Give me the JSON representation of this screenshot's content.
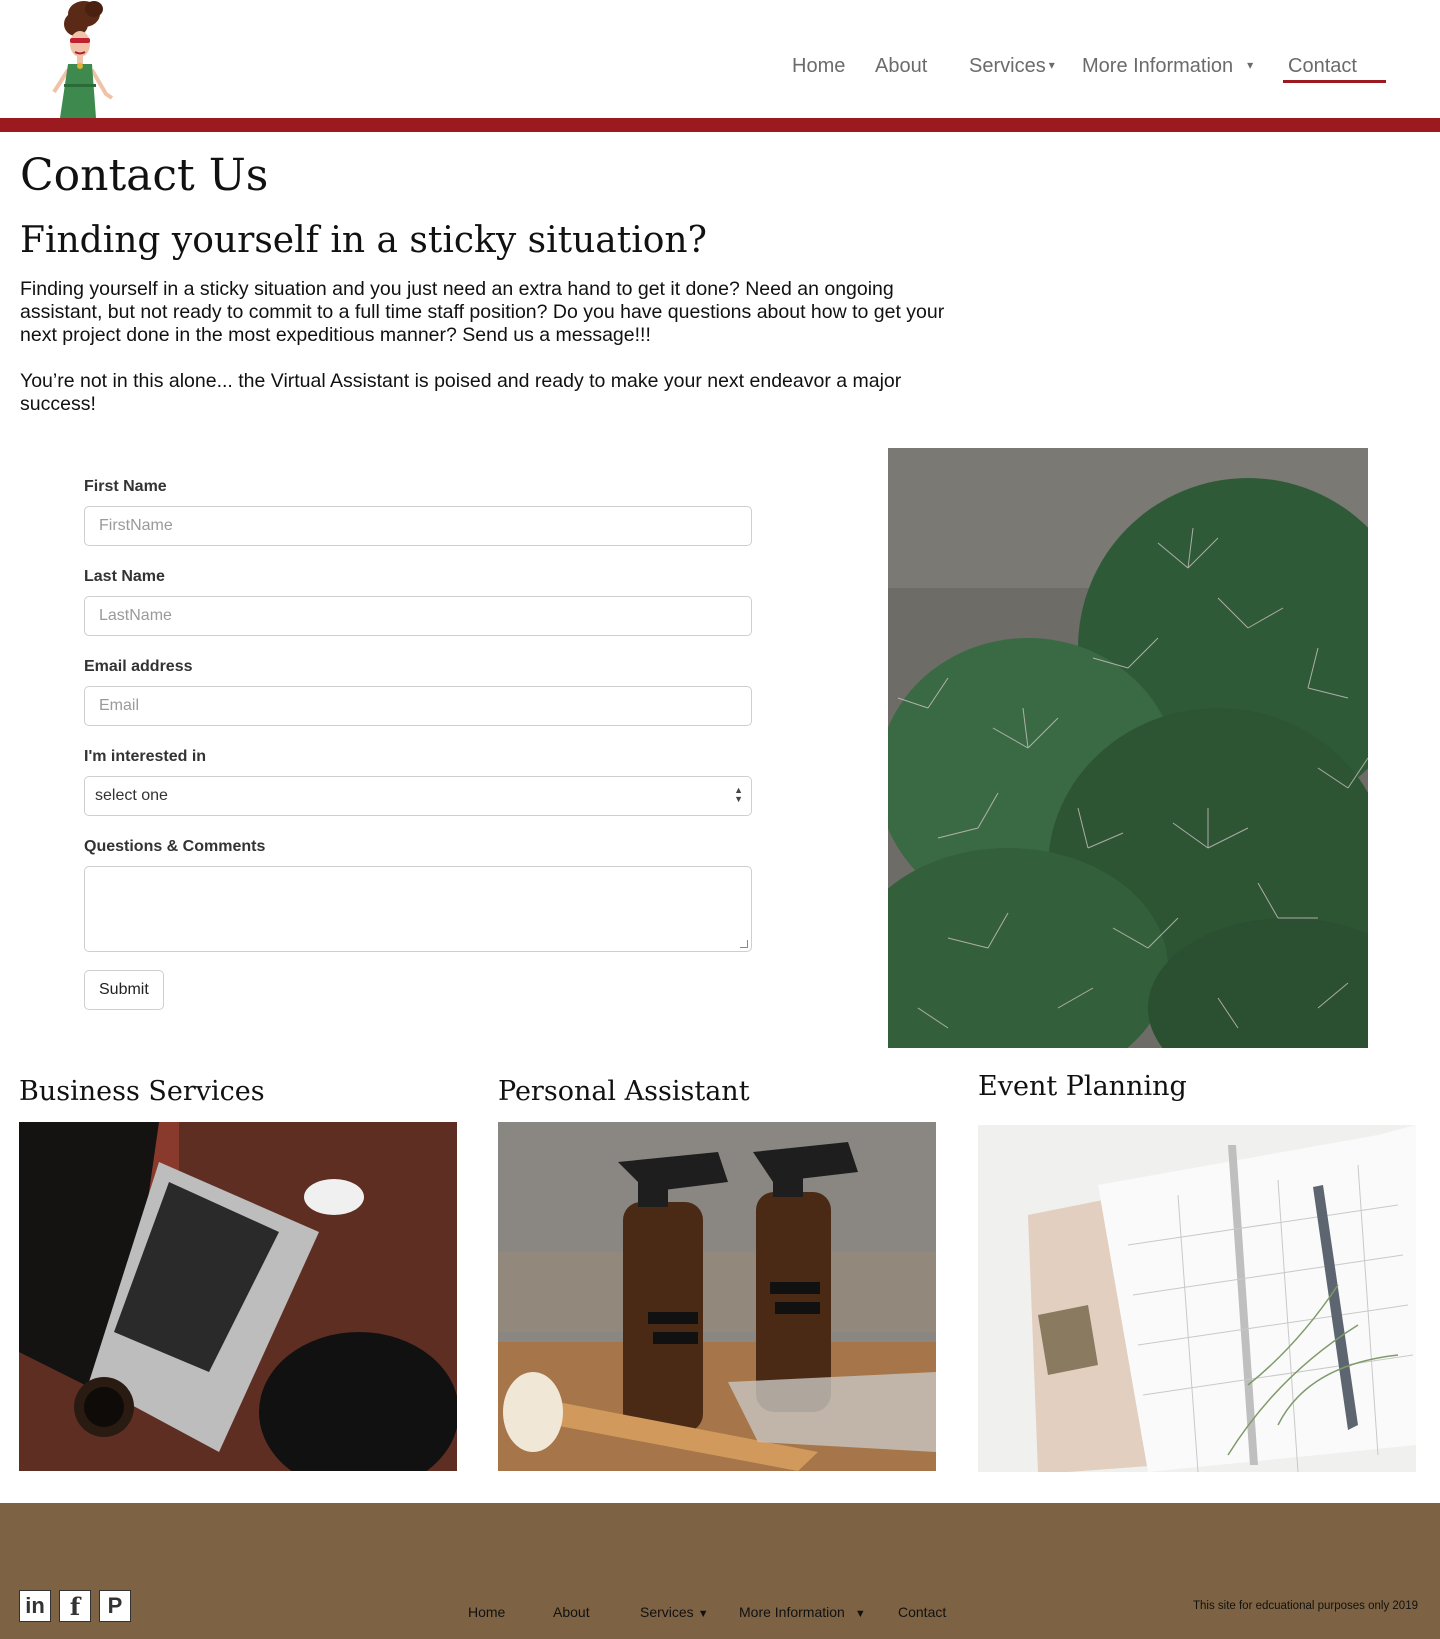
{
  "nav": {
    "items": [
      {
        "label": "Home"
      },
      {
        "label": "About"
      },
      {
        "label": "Services",
        "caret": "▾"
      },
      {
        "label": "More Information",
        "caret": "▾"
      },
      {
        "label": "Contact"
      }
    ],
    "active": "Contact"
  },
  "colors": {
    "accent": "#9a1a20",
    "footer_bg": "#7d6343"
  },
  "main": {
    "title": "Contact Us",
    "subtitle": "Finding yourself in a sticky situation?",
    "paragraph1": "Finding yourself in a sticky situation and you just need an extra hand to get it done?  Need an ongoing assistant, but not ready to commit to a full time staff position?  Do you have questions about how to get your next project done in the most expeditious manner?  Send us a message!!!",
    "paragraph2": "You’re not in this alone... the Virtual Assistant is poised and ready to make your next endeavor a major success!"
  },
  "form": {
    "first_name_label": "First Name",
    "first_name_placeholder": "FirstName",
    "first_name_value": "",
    "last_name_label": "Last Name",
    "last_name_placeholder": "LastName",
    "last_name_value": "",
    "email_label": "Email address",
    "email_placeholder": "Email",
    "email_value": "",
    "interest_label": "I'm interested in",
    "interest_selected": "select one",
    "comments_label": "Questions & Comments",
    "comments_value": "",
    "submit_label": "Submit"
  },
  "services": [
    {
      "title": "Business Services",
      "image": "laptop-on-desk"
    },
    {
      "title": "Personal Assistant",
      "image": "cleaning-spray-bottles"
    },
    {
      "title": "Event Planning",
      "image": "planner-with-pen"
    }
  ],
  "footer": {
    "social": [
      {
        "name": "linkedin-icon",
        "glyph": "in"
      },
      {
        "name": "facebook-icon",
        "glyph": "f"
      },
      {
        "name": "pinterest-icon",
        "glyph": "P"
      }
    ],
    "nav": [
      {
        "label": "Home"
      },
      {
        "label": "About"
      },
      {
        "label": "Services",
        "caret": "▼"
      },
      {
        "label": "More Information",
        "caret": "▼"
      },
      {
        "label": "Contact"
      }
    ],
    "note": "This site for edcuational purposes only 2019"
  }
}
